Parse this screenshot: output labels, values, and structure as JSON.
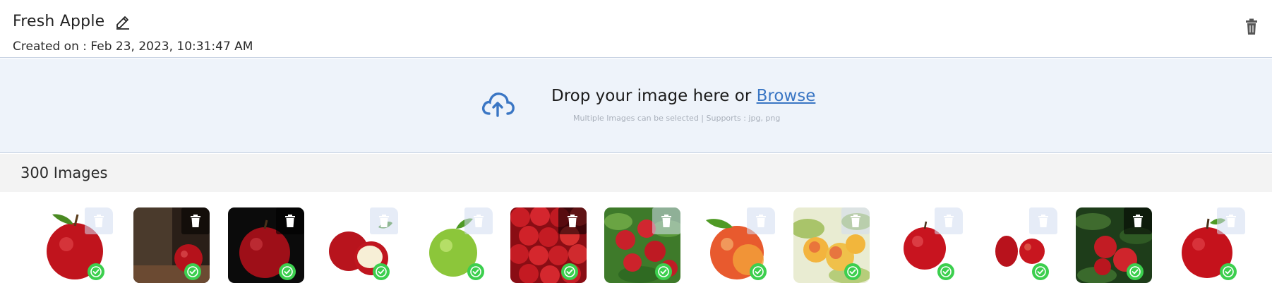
{
  "header": {
    "title": "Fresh Apple",
    "created_label": "Created on : Feb 23, 2023, 10:31:47 AM",
    "edit_icon": "pencil-icon",
    "delete_icon": "trash-icon"
  },
  "dropzone": {
    "text": "Drop your image here or ",
    "browse_label": "Browse",
    "subtext": "Multiple Images can be selected | Supports : jpg, png",
    "icon": "cloud-upload-icon",
    "accent_color": "#3a76c4"
  },
  "gallery": {
    "count_label": "300 Images",
    "status_icon": "check-circle-icon",
    "status_color": "#3ccf4e",
    "items": [
      {
        "name": "red apple with leaf",
        "background": "white"
      },
      {
        "name": "apple on wooden table",
        "background": "dark"
      },
      {
        "name": "red apple on black",
        "background": "black"
      },
      {
        "name": "cut red apple",
        "background": "white"
      },
      {
        "name": "green apple",
        "background": "white"
      },
      {
        "name": "pile of red apples",
        "background": "red"
      },
      {
        "name": "apples on tree branch",
        "background": "foliage"
      },
      {
        "name": "yellow-red apple with leaf",
        "background": "white"
      },
      {
        "name": "yellow apples on branch",
        "background": "light foliage"
      },
      {
        "name": "single red apple",
        "background": "white"
      },
      {
        "name": "two red apples",
        "background": "white"
      },
      {
        "name": "apples among dark leaves",
        "background": "dark foliage"
      },
      {
        "name": "red apple with stem",
        "background": "white"
      }
    ]
  }
}
